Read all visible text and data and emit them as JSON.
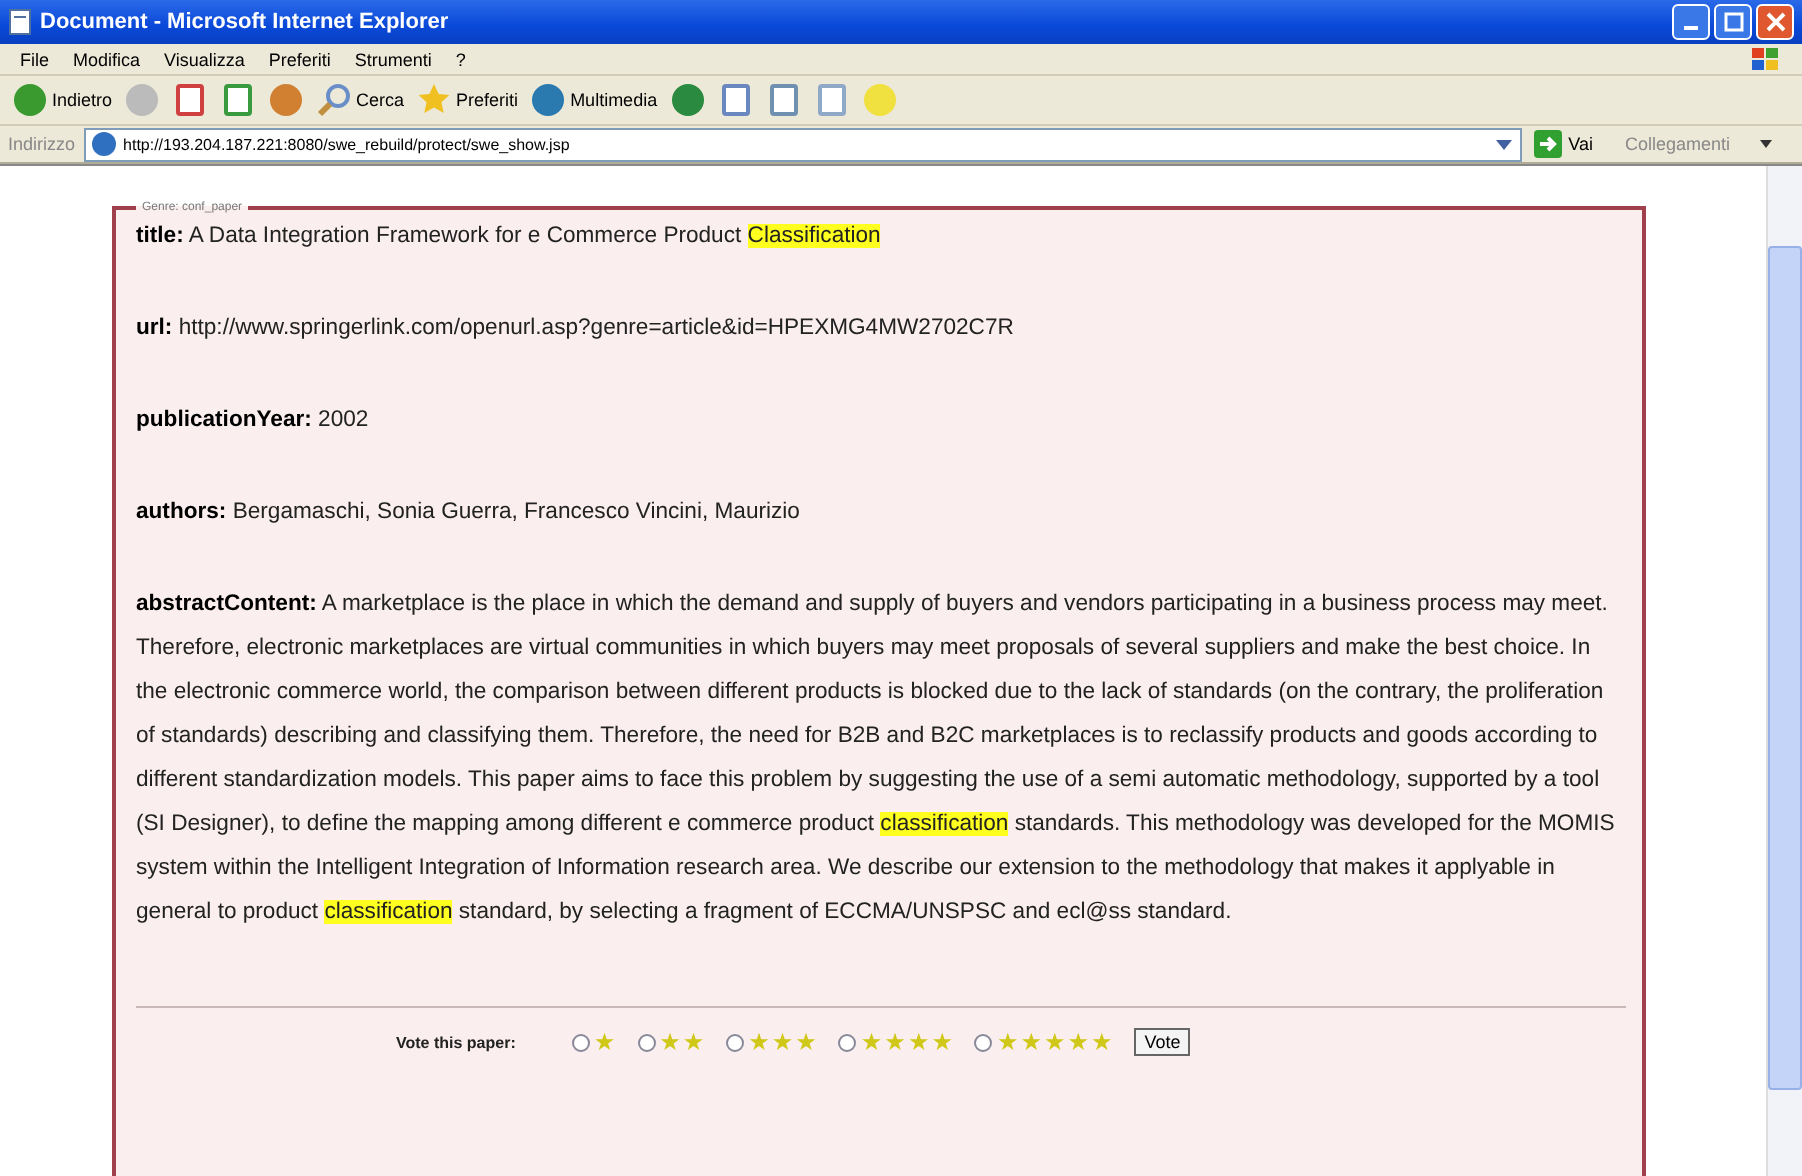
{
  "window": {
    "title": "Document - Microsoft Internet Explorer"
  },
  "menu": [
    "File",
    "Modifica",
    "Visualizza",
    "Preferiti",
    "Strumenti",
    "?"
  ],
  "toolbar": [
    {
      "kind": "back",
      "label": "Indietro"
    },
    {
      "kind": "forward"
    },
    {
      "kind": "stop"
    },
    {
      "kind": "refresh"
    },
    {
      "kind": "home"
    },
    {
      "kind": "search",
      "label": "Cerca"
    },
    {
      "kind": "favorites",
      "label": "Preferiti"
    },
    {
      "kind": "media",
      "label": "Multimedia"
    },
    {
      "kind": "history"
    },
    {
      "kind": "mail"
    },
    {
      "kind": "print"
    },
    {
      "kind": "edit"
    },
    {
      "kind": "messenger"
    }
  ],
  "address": {
    "label": "Indirizzo",
    "value": "http://193.204.187.221:8080/swe_rebuild/protect/swe_show.jsp",
    "go": "Vai",
    "links": "Collegamenti"
  },
  "record": {
    "legend": "Genre: conf_paper",
    "fields": [
      {
        "label": "title:",
        "segments": [
          {
            "text": "A Data Integration Framework for e Commerce Product ",
            "highlighted": false
          },
          {
            "text": "Classification",
            "highlighted": true
          }
        ]
      },
      {
        "label": "url:",
        "segments": [
          {
            "text": "http://www.springerlink.com/openurl.asp?genre=article&id=HPEXMG4MW2702C7R",
            "highlighted": false
          }
        ]
      },
      {
        "label": "publicationYear:",
        "segments": [
          {
            "text": "2002",
            "highlighted": false
          }
        ]
      },
      {
        "label": "authors:",
        "segments": [
          {
            "text": "Bergamaschi, Sonia Guerra, Francesco Vincini, Maurizio",
            "highlighted": false
          }
        ]
      },
      {
        "label": "abstractContent:",
        "segments": [
          {
            "text": "A marketplace is the place in which the demand and supply of buyers and vendors participating in a business process may meet. Therefore, electronic marketplaces are virtual communities in which buyers may meet proposals of several suppliers and make the best choice. In the electronic commerce world, the comparison between different products is blocked due to the lack of standards (on the contrary, the proliferation of standards) describing and classifying them. Therefore, the need for B2B and B2C marketplaces is to reclassify products and goods according to different standardization models. This paper aims to face this problem by suggesting the use of a semi automatic methodology, supported by a tool (SI Designer), to define the mapping among different e commerce product ",
            "highlighted": false
          },
          {
            "text": "classification",
            "highlighted": true
          },
          {
            "text": " standards. This methodology was developed for the MOMIS system within the Intelligent Integration of Information research area. We describe our extension to the methodology that makes it applyable in general to product ",
            "highlighted": false
          },
          {
            "text": "classification",
            "highlighted": true
          },
          {
            "text": " standard, by selecting a fragment of ECCMA/UNSPSC and ecl@ss standard.",
            "highlighted": false
          }
        ]
      }
    ]
  },
  "vote": {
    "label": "Vote this paper:",
    "options": [
      {
        "label": "★",
        "selected": false
      },
      {
        "label": "★★",
        "selected": false
      },
      {
        "label": "★★★",
        "selected": false
      },
      {
        "label": "★★★★",
        "selected": false
      },
      {
        "label": "★★★★★",
        "selected": false
      }
    ],
    "button": "Vote"
  }
}
